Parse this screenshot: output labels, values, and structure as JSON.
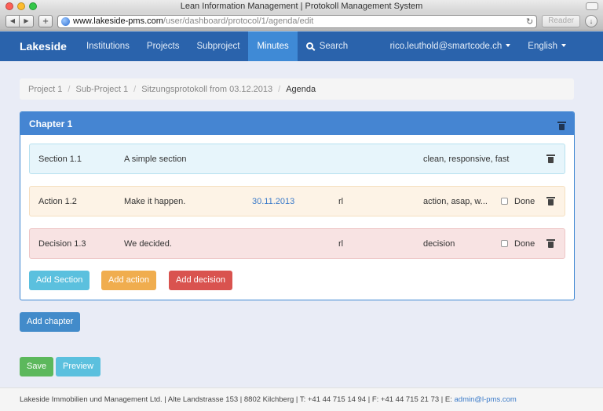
{
  "window": {
    "title": "Lean Information Management | Protokoll Management System"
  },
  "browser": {
    "url_host": "www.lakeside-pms.com",
    "url_path": "/user/dashboard/protocol/1/agenda/edit",
    "reader_label": "Reader"
  },
  "navbar": {
    "brand": "Lakeside",
    "items": [
      {
        "label": "Institutions"
      },
      {
        "label": "Projects"
      },
      {
        "label": "Subproject"
      },
      {
        "label": "Minutes",
        "active": true
      }
    ],
    "search_label": "Search",
    "user": "rico.leuthold@smartcode.ch",
    "language": "English"
  },
  "breadcrumb": [
    "Project 1",
    "Sub-Project 1",
    "Sitzungsprotokoll from 03.12.2013",
    "Agenda"
  ],
  "chapter": {
    "title": "Chapter 1",
    "rows": [
      {
        "type": "section",
        "number": "Section 1.1",
        "text": "A simple section",
        "tags": "clean, responsive, fast"
      },
      {
        "type": "action",
        "number": "Action 1.2",
        "text": "Make it happen.",
        "date": "30.11.2013",
        "responsible": "rl",
        "tags": "action, asap, w...",
        "done_label": "Done"
      },
      {
        "type": "decision",
        "number": "Decision 1.3",
        "text": "We decided.",
        "responsible": "rl",
        "tags": "decision",
        "done_label": "Done"
      }
    ],
    "buttons": {
      "add_section": "Add Section",
      "add_action": "Add action",
      "add_decision": "Add decision"
    }
  },
  "buttons": {
    "add_chapter": "Add chapter",
    "save": "Save",
    "preview": "Preview"
  },
  "footer": {
    "text": "Lakeside Immobilien und Management Ltd. | Alte Landstrasse 153 | 8802 Kilchberg | T: +41 44 715 14 94 | F: +41 44 715 21 73 | E: ",
    "email": "admin@l-pms.com"
  }
}
